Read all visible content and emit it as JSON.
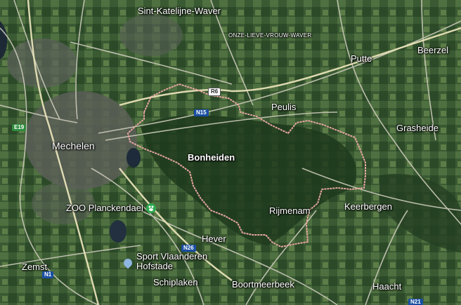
{
  "map": {
    "places": {
      "sint_katelijne_waver": "Sint-Katelijne-Waver",
      "onze_lieve_vrouw_waver": "ONZE-LIEVE-VROUW-WAVER",
      "putte": "Putte",
      "beerzel": "Beerzel",
      "peulis": "Peulis",
      "grasheide": "Grasheide",
      "mechelen": "Mechelen",
      "bonheiden": "Bonheiden",
      "rijmenam": "Rijmenam",
      "keerbergen": "Keerbergen",
      "hever": "Hever",
      "zemst": "Zemst",
      "schiplaken": "Schiplaken",
      "boortmeerbeek": "Boortmeerbeek",
      "haacht": "Haacht"
    },
    "pois": {
      "zoo": "ZOO Planckendael",
      "sport": "Sport Vlaanderen Hofstade"
    },
    "roads": {
      "r6": "R6",
      "n15": "N15",
      "e19": "E19",
      "n26": "N26",
      "n1": "N1",
      "n21": "N21"
    },
    "colors": {
      "boundary": "#e6a6a0",
      "road_shield": "#1a4fa3",
      "e_road_shield": "#2e8b3d",
      "zoo_pin": "#2fa84f",
      "place_pin": "#8fb6e0"
    },
    "icons": {
      "zoo": "zoo-icon",
      "place": "location-pin-icon"
    }
  }
}
